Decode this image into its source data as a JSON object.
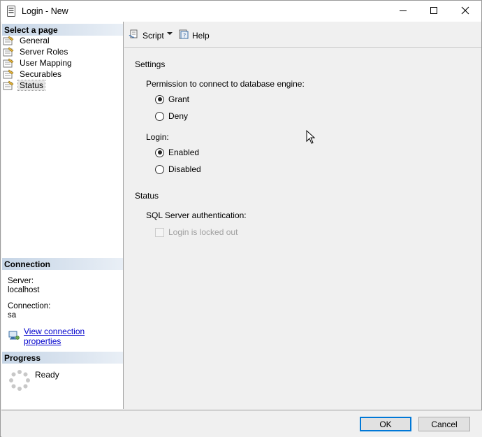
{
  "window": {
    "title": "Login - New"
  },
  "left": {
    "select_page_header": "Select a page",
    "pages": [
      {
        "label": "General"
      },
      {
        "label": "Server Roles"
      },
      {
        "label": "User Mapping"
      },
      {
        "label": "Securables"
      },
      {
        "label": "Status",
        "selected": true
      }
    ],
    "connection_header": "Connection",
    "server_label": "Server:",
    "server_value": "localhost",
    "connection_label": "Connection:",
    "connection_value": "sa",
    "view_connection_link": "View connection properties",
    "progress_header": "Progress",
    "progress_status": "Ready"
  },
  "toolbar": {
    "script_label": "Script",
    "help_label": "Help"
  },
  "main": {
    "settings_heading": "Settings",
    "permission_label": "Permission to connect to database engine:",
    "grant_label": "Grant",
    "deny_label": "Deny",
    "permission_value": "Grant",
    "login_label": "Login:",
    "enabled_label": "Enabled",
    "disabled_label": "Disabled",
    "login_value": "Enabled",
    "status_heading": "Status",
    "sql_auth_label": "SQL Server authentication:",
    "locked_out_label": "Login is locked out",
    "locked_out_checked": false
  },
  "buttons": {
    "ok_label": "OK",
    "cancel_label": "Cancel"
  },
  "colors": {
    "section_header": "#c6d5e6",
    "link": "#0000cc",
    "default_button_border": "#0078d7"
  }
}
